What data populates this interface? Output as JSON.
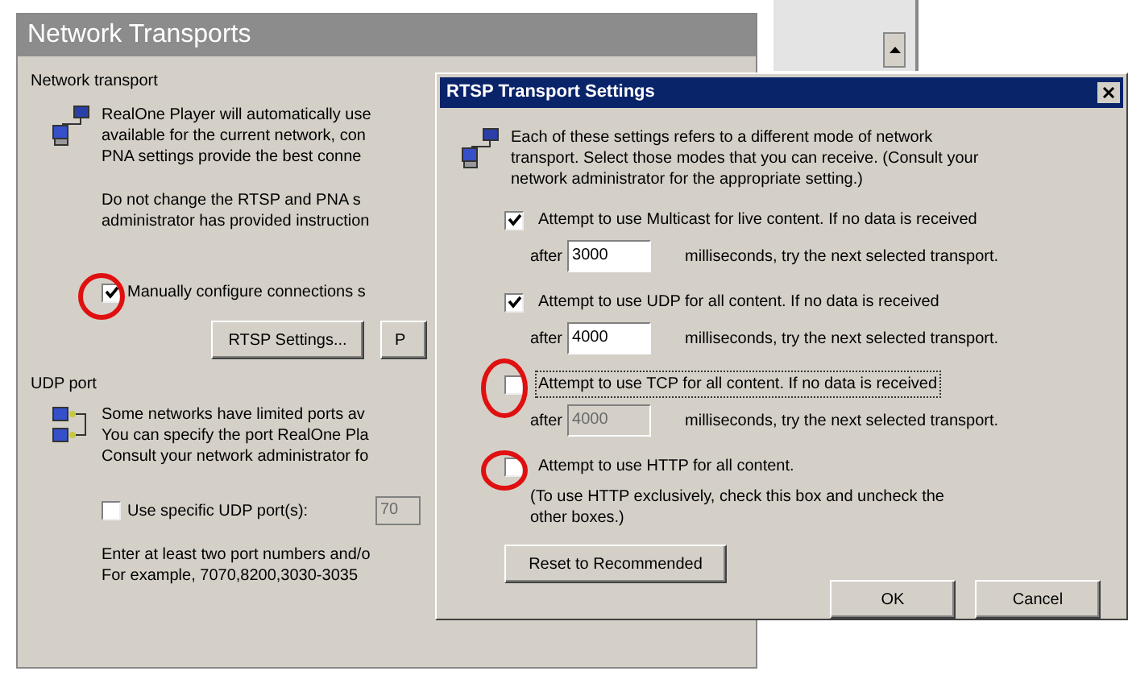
{
  "network_transports": {
    "title": "Network Transports",
    "network_transport": {
      "label": "Network transport",
      "paragraph_1": [
        "RealOne Player will automatically use",
        "available for the current network, con",
        "PNA settings provide the best conne"
      ],
      "paragraph_2": [
        "Do not change the RTSP and PNA s",
        "administrator has provided instruction"
      ],
      "manual_checkbox": {
        "label": "Manually configure connections s",
        "checked": true
      },
      "buttons": [
        "RTSP Settings...",
        "P"
      ]
    },
    "udp_port": {
      "label": "UDP port",
      "paragraph": [
        "Some networks have limited ports av",
        "You can specify the port RealOne Pla",
        "Consult your network administrator fo"
      ],
      "udp_checkbox": {
        "label": "Use specific UDP port(s):",
        "checked": false
      },
      "port_field": {
        "value": "70",
        "disabled": true
      },
      "hint": [
        "Enter at least two port numbers and/o",
        "For example, 7070,8200,3030-3035"
      ]
    }
  },
  "rtsp_dialog": {
    "title": "RTSP Transport Settings",
    "intro": [
      "Each of these settings refers to a different mode of network",
      "transport. Select those modes that you can receive. (Consult your",
      "network administrator for the appropriate setting.)"
    ],
    "options": [
      {
        "kind": "timeout",
        "label": "Attempt to use Multicast for live content.  If no data is received",
        "checked": true,
        "focused": false,
        "after": "after",
        "value": "3000",
        "disabled": false,
        "suffix": "milliseconds, try the next selected transport."
      },
      {
        "kind": "timeout",
        "label": "Attempt to use UDP for all content.  If no data is received",
        "checked": true,
        "focused": false,
        "after": "after",
        "value": "4000",
        "disabled": false,
        "suffix": "milliseconds, try the next selected transport."
      },
      {
        "kind": "timeout",
        "label": "Attempt to use TCP for all content.  If no data is received",
        "checked": false,
        "focused": true,
        "after": "after",
        "value": "4000",
        "disabled": true,
        "suffix": "milliseconds, try the next selected transport."
      },
      {
        "kind": "note",
        "label": "Attempt to use HTTP for all content.",
        "checked": false,
        "focused": false,
        "note": [
          "(To use HTTP exclusively, check this box and uncheck the",
          "other boxes.)"
        ]
      }
    ],
    "reset_button": "Reset to Recommended",
    "buttons": [
      "OK",
      "Cancel"
    ]
  }
}
